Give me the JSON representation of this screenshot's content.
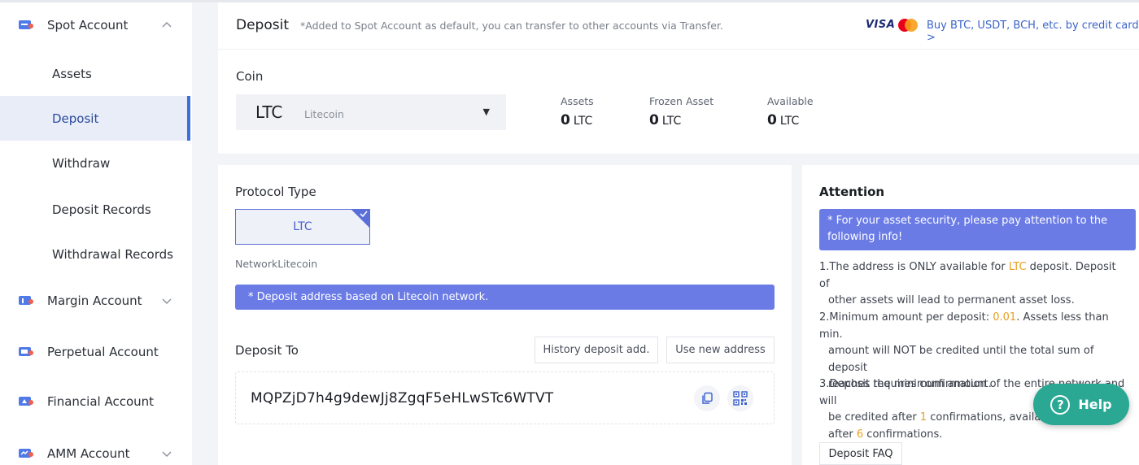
{
  "sidebar": {
    "groups": [
      {
        "label": "Spot Account",
        "icon": "spot-account-icon",
        "expanded": true
      },
      {
        "label": "Margin Account",
        "icon": "margin-account-icon",
        "expanded": false
      },
      {
        "label": "Perpetual Account",
        "icon": "perpetual-account-icon",
        "expanded": false
      },
      {
        "label": "Financial Account",
        "icon": "financial-account-icon",
        "expanded": false
      },
      {
        "label": "AMM Account",
        "icon": "amm-account-icon",
        "expanded": false
      }
    ],
    "spot_items": [
      {
        "label": "Assets",
        "active": false
      },
      {
        "label": "Deposit",
        "active": true
      },
      {
        "label": "Withdraw",
        "active": false
      },
      {
        "label": "Deposit Records",
        "active": false
      },
      {
        "label": "Withdrawal Records",
        "active": false
      }
    ]
  },
  "header": {
    "title": "Deposit",
    "note": "*Added to Spot Account as default, you can transfer to other accounts via Transfer.",
    "visa": "VISA",
    "mastercard": "MasterCard",
    "buy_link": "Buy BTC, USDT, BCH, etc. by credit card >"
  },
  "coin": {
    "label": "Coin",
    "symbol": "LTC",
    "name": "Litecoin",
    "stats": [
      {
        "label": "Assets",
        "value": "0",
        "unit": "LTC"
      },
      {
        "label": "Frozen Asset",
        "value": "0",
        "unit": "LTC"
      },
      {
        "label": "Available",
        "value": "0",
        "unit": "LTC"
      }
    ]
  },
  "deposit": {
    "protocol_label": "Protocol Type",
    "protocol_option": "LTC",
    "network_text": "NetworkLitecoin",
    "address_note": "* Deposit address based on Litecoin network.",
    "deposit_to_label": "Deposit To",
    "history_button": "History deposit add.",
    "new_address_button": "Use new address",
    "address": "MQPZjD7h4g9dewJj8ZgqF5eHLwSTc6WTVT"
  },
  "attention": {
    "title": "Attention",
    "note": "* For your asset security, please pay attention to the following info!",
    "item1": {
      "pre": "1.The address is ONLY available for ",
      "hl": "LTC",
      "post": " deposit. Deposit of",
      "line2": "other assets will lead to permanent asset loss."
    },
    "item2": {
      "pre": "2.Minimum amount per deposit: ",
      "hl": "0.01",
      "post": ". Assets less than min.",
      "line2": "amount will NOT be credited until the total sum of deposit",
      "line3": "reaches the minimum amount."
    },
    "item3": {
      "line1": "3.Deposit requires confirmation of the entire network and will",
      "pre2": "be credited after ",
      "hl2": "1",
      "post2": " confirmations, availab",
      "pre3": "after ",
      "hl3": "6",
      "post3": " confirmations."
    },
    "faq_button": "Deposit FAQ"
  },
  "help": {
    "label": "Help",
    "icon": "?"
  },
  "colors": {
    "accent": "#6a7be6",
    "brand_blue": "#3c6edc",
    "highlight": "#e6a020",
    "help_green": "#2aa893"
  }
}
